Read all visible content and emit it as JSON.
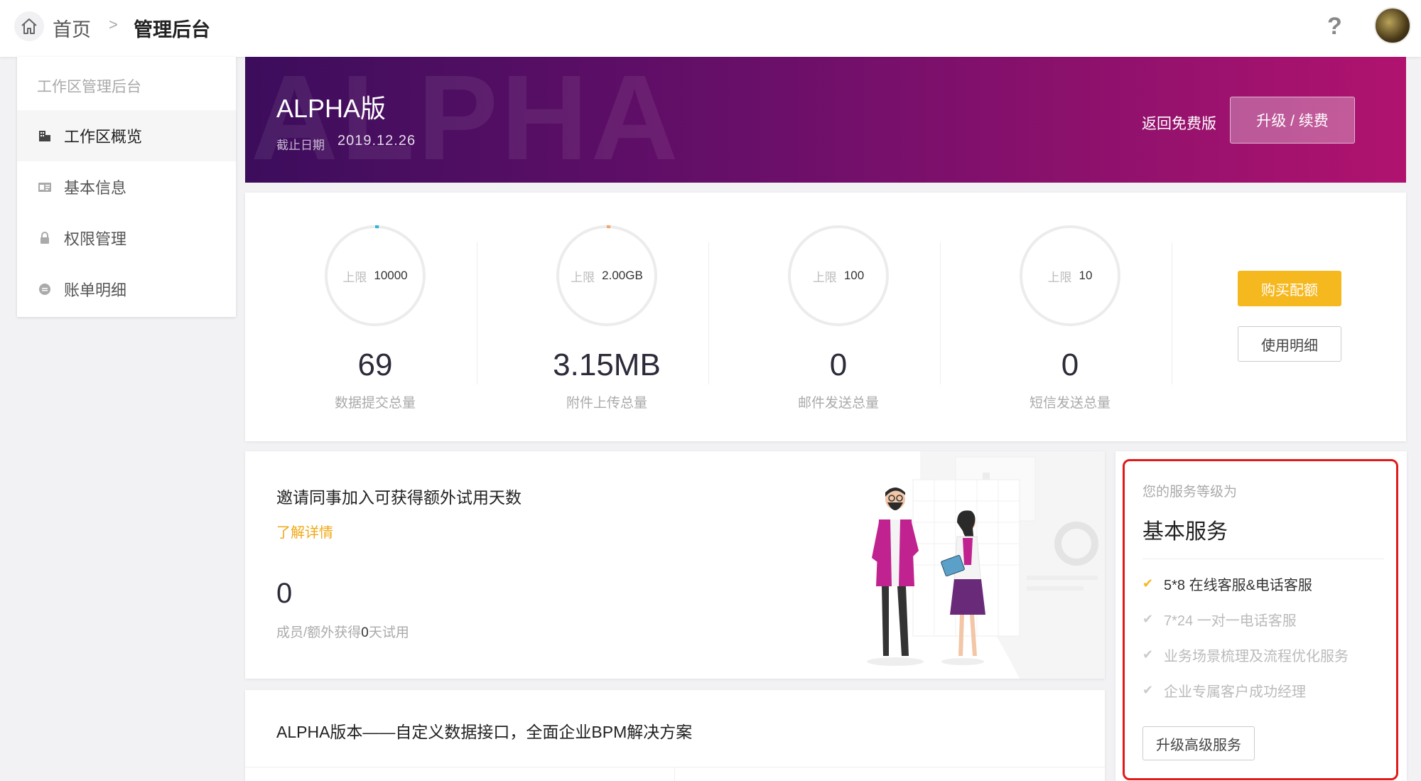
{
  "topbar": {
    "home_icon": "home-icon",
    "breadcrumb_home": "首页",
    "breadcrumb_separator": ">",
    "breadcrumb_current": "管理后台",
    "help_icon": "?"
  },
  "sidebar": {
    "title": "工作区管理后台",
    "items": [
      {
        "label": "工作区概览",
        "icon": "building-icon",
        "active": true
      },
      {
        "label": "基本信息",
        "icon": "id-card-icon",
        "active": false
      },
      {
        "label": "权限管理",
        "icon": "lock-icon",
        "active": false
      },
      {
        "label": "账单明细",
        "icon": "coin-icon",
        "active": false
      }
    ]
  },
  "banner": {
    "watermark": "ALPHA",
    "title": "ALPHA版",
    "date_label": "截止日期",
    "date": "2019.12.26",
    "return_link": "返回免费版",
    "upgrade_button": "升级 / 续费",
    "colors": {
      "start": "#3c0d5c",
      "end": "#b0136f"
    }
  },
  "stats": {
    "limit_label": "上限",
    "items": [
      {
        "limit": "10000",
        "value": "69",
        "label": "数据提交总量",
        "usage_fraction": 0.0069,
        "ring_color": "#2bb5d8"
      },
      {
        "limit": "2.00GB",
        "value": "3.15MB",
        "label": "附件上传总量",
        "usage_fraction": 0.0015,
        "ring_color": "#f3a56b"
      },
      {
        "limit": "100",
        "value": "0",
        "label": "邮件发送总量",
        "usage_fraction": 0,
        "ring_color": "#cccccc"
      },
      {
        "limit": "10",
        "value": "0",
        "label": "短信发送总量",
        "usage_fraction": 0,
        "ring_color": "#cccccc"
      }
    ],
    "buy_button": "购买配额",
    "detail_button": "使用明细"
  },
  "invite": {
    "title": "邀请同事加入可获得额外试用天数",
    "link": "了解详情",
    "count": "0",
    "note_prefix": "成员/额外获得",
    "note_days": "0",
    "note_suffix": "天试用"
  },
  "service": {
    "caption": "您的服务等级为",
    "level": "基本服务",
    "features": [
      {
        "label": "5*8 在线客服&电话客服",
        "enabled": true
      },
      {
        "label": "7*24 一对一电话客服",
        "enabled": false
      },
      {
        "label": "业务场景梳理及流程优化服务",
        "enabled": false
      },
      {
        "label": "企业专属客户成功经理",
        "enabled": false
      }
    ],
    "check_icon": "✔",
    "upgrade_button": "升级高级服务",
    "highlight_color": "#e01a1a"
  },
  "bottom": {
    "title": "ALPHA版本——自定义数据接口，全面企业BPM解决方案"
  }
}
